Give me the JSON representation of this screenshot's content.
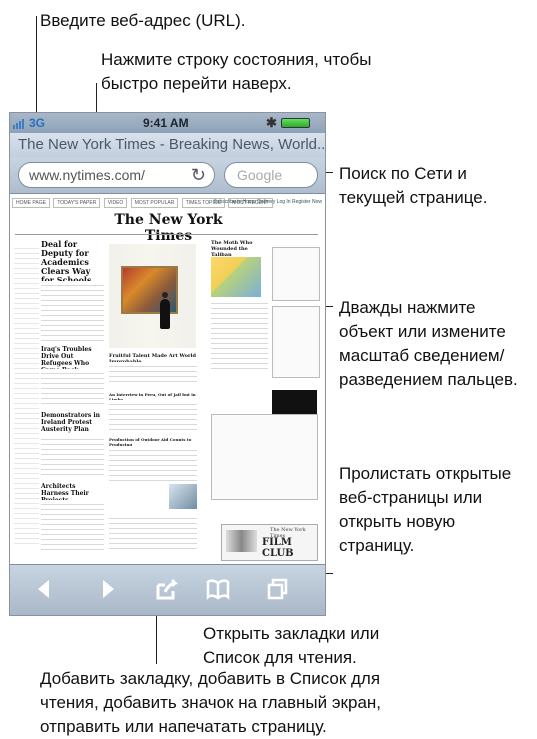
{
  "callouts": {
    "url_hint": "Введите веб-адрес (URL).",
    "status_hint": "Нажмите строку состояния, чтобы\nбыстро перейти наверх.",
    "search_hint": "Поиск по Сети и\nтекущей странице.",
    "zoom_hint": "Дважды нажмите\nобъект или измените\nмасштаб сведением/\nразведением пальцев.",
    "pages_hint": "Пролистать открытые\nвеб-страницы или\nоткрыть новую\nстраницу.",
    "bookmarks_hint": "Открыть закладки или\nСписок для чтения.",
    "share_hint": "Добавить закладку, добавить в Список для\nчтения, добавить значок на главный экран,\nотправить или напечатать страницу."
  },
  "phone": {
    "status": {
      "signal": "3G",
      "time": "9:41 AM",
      "bluetooth_icon": "bluetooth-icon",
      "battery_icon": "battery-icon"
    },
    "page_title": "The New York Times - Breaking News, World...",
    "url_value": "www.nytimes.com/",
    "search_placeholder": "Google",
    "toolbar": {
      "back_icon": "back-arrow-icon",
      "forward_icon": "forward-arrow-icon",
      "share_icon": "share-icon",
      "bookmarks_icon": "bookmarks-icon",
      "pages_icon": "pages-icon"
    },
    "website": {
      "top_links": [
        "HOME PAGE",
        "TODAY'S PAPER",
        "VIDEO",
        "MOST POPULAR",
        "TIMES TOPICS",
        "MOST RECENT"
      ],
      "top_right_links": "Subscribe to Home Delivery  Log In  Register Now",
      "masthead": "The New York Times",
      "main_headline": "Deal for Deputy for Academics Clears Way for Schools Chief",
      "story2": "Iraq's Troubles Drive Out Refugees Who Came Back",
      "story3": "Demonstrators in Ireland Protest Austerity Plan",
      "story4": "Architects Harness Their Projects",
      "photo_caption": "Fruitful Talent Made Art World Improbable",
      "side_story1": "An Interview in Peru, Out of Jail but in Limbo",
      "side_story2": "Production of Outdoor Aid Counts to Producing",
      "right_story": "The Moth Who Wounded the Taliban",
      "film_title": "FILM CLUB",
      "newspaper_small": "The New York Times"
    }
  }
}
